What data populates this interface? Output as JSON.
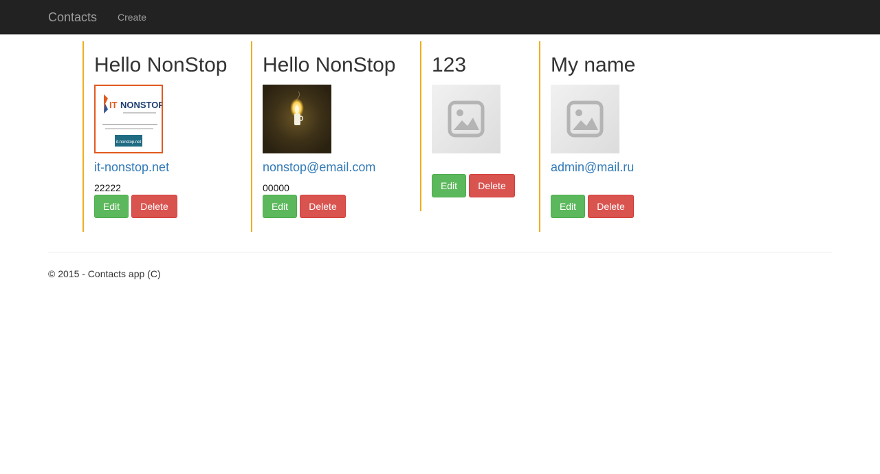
{
  "navbar": {
    "brand": "Contacts",
    "links": [
      "Create"
    ]
  },
  "contacts": [
    {
      "name": "Hello NonStop",
      "link": "it-nonstop.net",
      "phone": "22222",
      "image": "it-nonstop-logo-image",
      "image_text": {
        "logo": "NONSTOP",
        "button": "it-nonstop.net"
      },
      "edit": "Edit",
      "delete": "Delete"
    },
    {
      "name": "Hello NonStop",
      "link": "nonstop@email.com",
      "phone": "00000",
      "image": "candle-photo",
      "edit": "Edit",
      "delete": "Delete"
    },
    {
      "name": "123",
      "link": "",
      "phone": "",
      "image": "image-placeholder-icon",
      "edit": "Edit",
      "delete": "Delete"
    },
    {
      "name": "My name",
      "link": "admin@mail.ru",
      "phone": "",
      "image": "image-placeholder-icon",
      "edit": "Edit",
      "delete": "Delete"
    }
  ],
  "footer": {
    "text": "© 2015 - Contacts app (C)"
  },
  "colors": {
    "navbar": "#222222",
    "accent_border": "#f0ad1e",
    "link": "#337ab7",
    "edit": "#5cb85c",
    "delete": "#d9534f"
  }
}
